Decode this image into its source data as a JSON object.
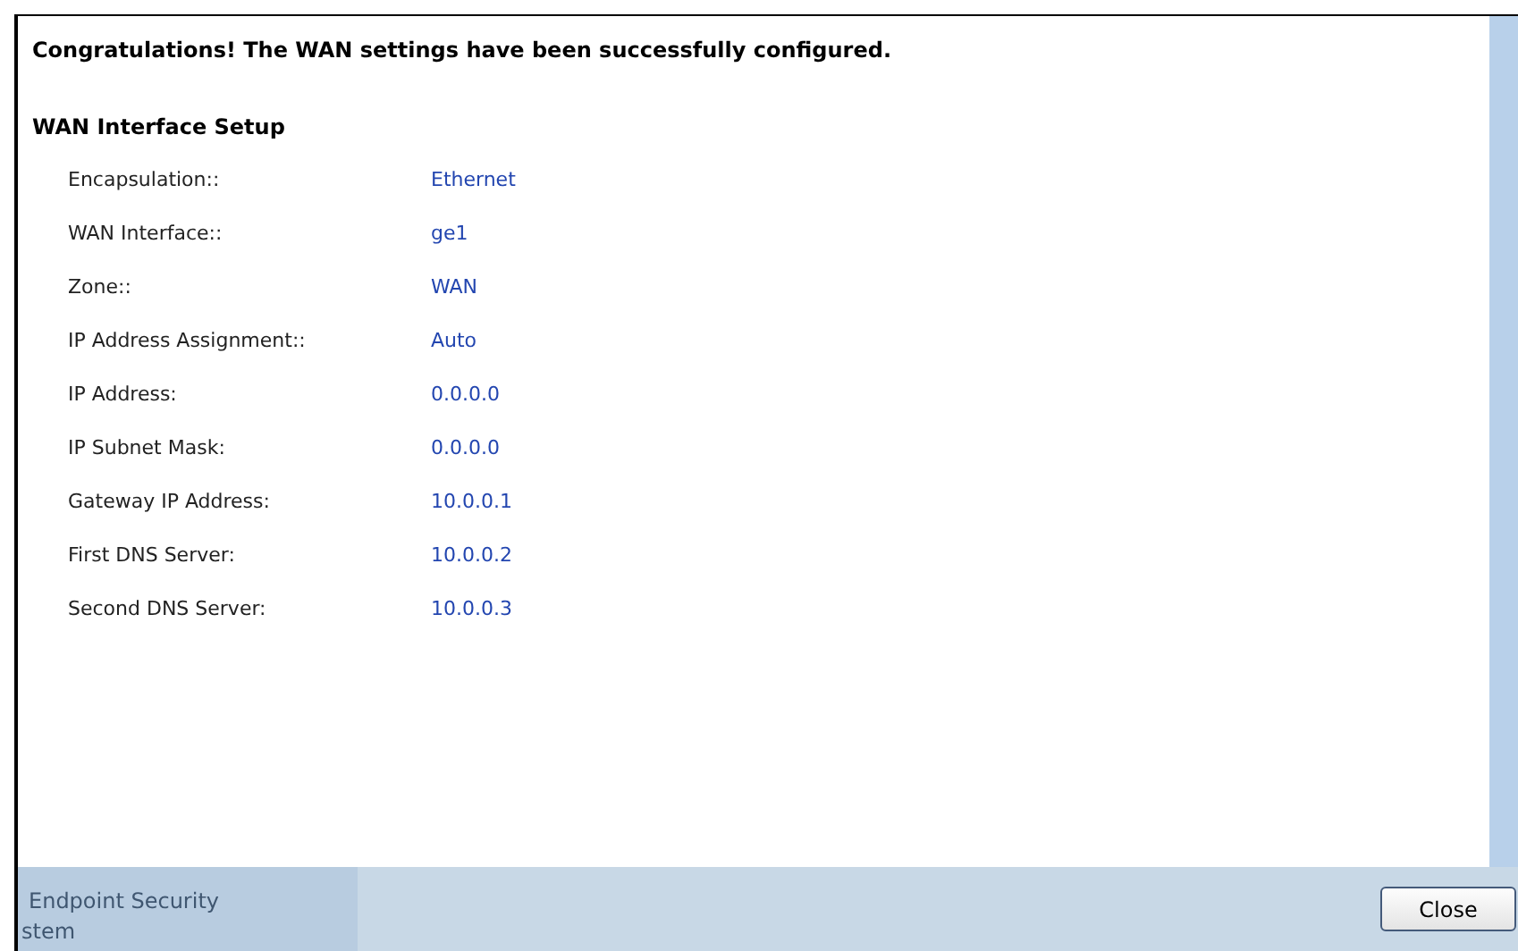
{
  "message": "Congratulations! The WAN settings have been successfully configured.",
  "section": {
    "title": "WAN Interface Setup",
    "rows": [
      {
        "label": "Encapsulation::",
        "value": "Ethernet"
      },
      {
        "label": "WAN Interface::",
        "value": "ge1"
      },
      {
        "label": "Zone::",
        "value": "WAN"
      },
      {
        "label": "IP Address Assignment::",
        "value": "Auto"
      },
      {
        "label": "IP Address:",
        "value": "0.0.0.0"
      },
      {
        "label": "IP Subnet Mask:",
        "value": "0.0.0.0"
      },
      {
        "label": "Gateway IP Address:",
        "value": "10.0.0.1"
      },
      {
        "label": "First DNS Server:",
        "value": "10.0.0.2"
      },
      {
        "label": "Second DNS Server:",
        "value": "10.0.0.3"
      }
    ]
  },
  "background_menu": [
    "Endpoint Security",
    "stem"
  ],
  "buttons": [
    "Close"
  ]
}
